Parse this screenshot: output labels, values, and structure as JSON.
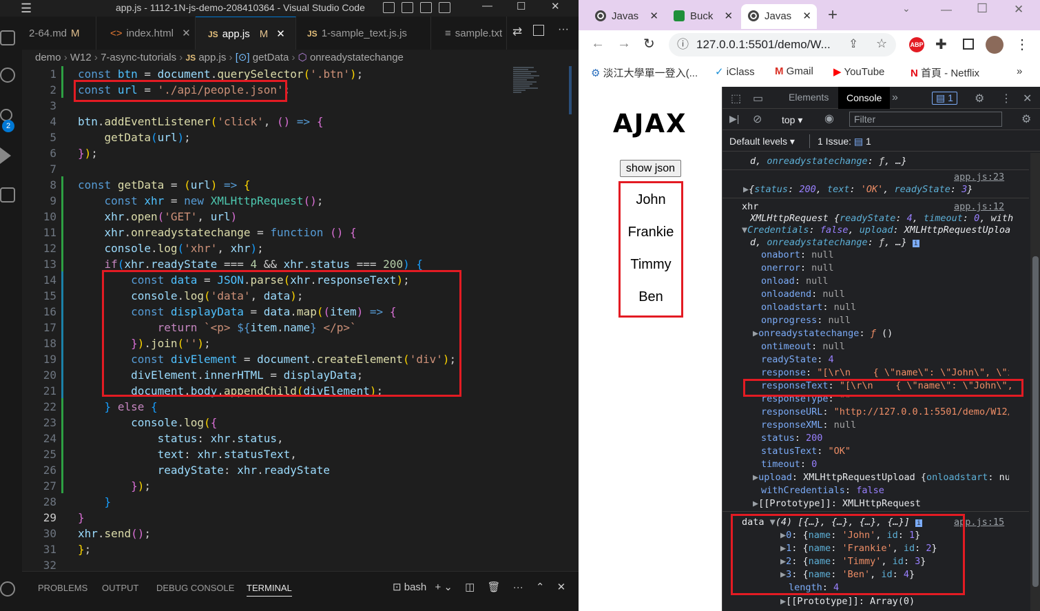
{
  "vscode": {
    "title": "app.js - 1112-1N-js-demo-208410364 - Visual Studio Code",
    "tabs": [
      {
        "label": "2-64.md",
        "mod": "M"
      },
      {
        "label": "index.html",
        "close": "✕"
      },
      {
        "label": "app.js",
        "mod": "M",
        "close": "✕"
      },
      {
        "label": "1-sample_text.js.js"
      },
      {
        "label": "sample.txt"
      }
    ],
    "breadcrumb": [
      "demo",
      "W12",
      "7-async-tutorials",
      "app.js",
      "getData",
      "onreadystatechange"
    ],
    "source_control_badge": "2",
    "panel_tabs": [
      "PROBLEMS",
      "OUTPUT",
      "DEBUG CONSOLE",
      "TERMINAL"
    ],
    "terminal_shell": "bash",
    "current_line": "29"
  },
  "browser": {
    "tabs": [
      "Javas",
      "Buck",
      "Javas"
    ],
    "address": "127.0.0.1:5501/demo/W...",
    "bookmarks": [
      "淡江大學單一登入(...",
      "iClass",
      "Gmail",
      "YouTube",
      "首頁 - Netflix"
    ],
    "page": {
      "heading": "AJAX",
      "button": "show json",
      "names": [
        "John",
        "Frankie",
        "Timmy",
        "Ben"
      ]
    },
    "devtools": {
      "tabs": [
        "Elements",
        "Console"
      ],
      "issues_badge": "1",
      "context": "top",
      "filter_placeholder": "Filter",
      "levels": "Default levels",
      "issue_count": "1 Issue:",
      "issue_number": "1"
    }
  },
  "colors": {
    "highlight_box": "#e31b23",
    "accent": "#0078d4"
  }
}
